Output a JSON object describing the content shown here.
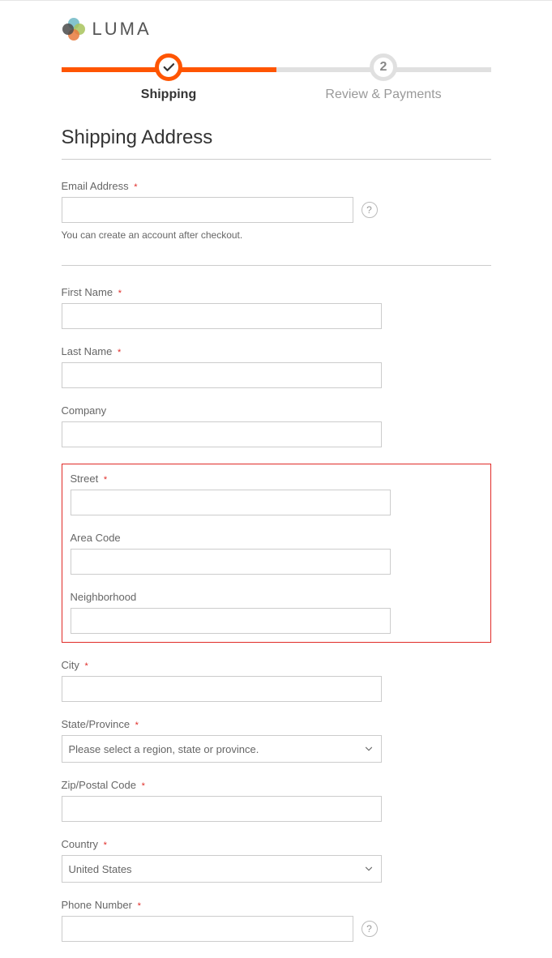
{
  "brand": "LUMA",
  "progress": {
    "step1_label": "Shipping",
    "step2_label": "Review & Payments",
    "step2_number": "2"
  },
  "section_title": "Shipping Address",
  "fields": {
    "email": {
      "label": "Email Address",
      "value": "",
      "helper": "You can create an account after checkout."
    },
    "first_name": {
      "label": "First Name",
      "value": ""
    },
    "last_name": {
      "label": "Last Name",
      "value": ""
    },
    "company": {
      "label": "Company",
      "value": ""
    },
    "street": {
      "label": "Street",
      "value": ""
    },
    "area_code": {
      "label": "Area Code",
      "value": ""
    },
    "neighborhood": {
      "label": "Neighborhood",
      "value": ""
    },
    "city": {
      "label": "City",
      "value": ""
    },
    "state": {
      "label": "State/Province",
      "placeholder": "Please select a region, state or province."
    },
    "zip": {
      "label": "Zip/Postal Code",
      "value": ""
    },
    "country": {
      "label": "Country",
      "value": "United States"
    },
    "phone": {
      "label": "Phone Number",
      "value": ""
    }
  },
  "required_mark": "*",
  "help_symbol": "?"
}
